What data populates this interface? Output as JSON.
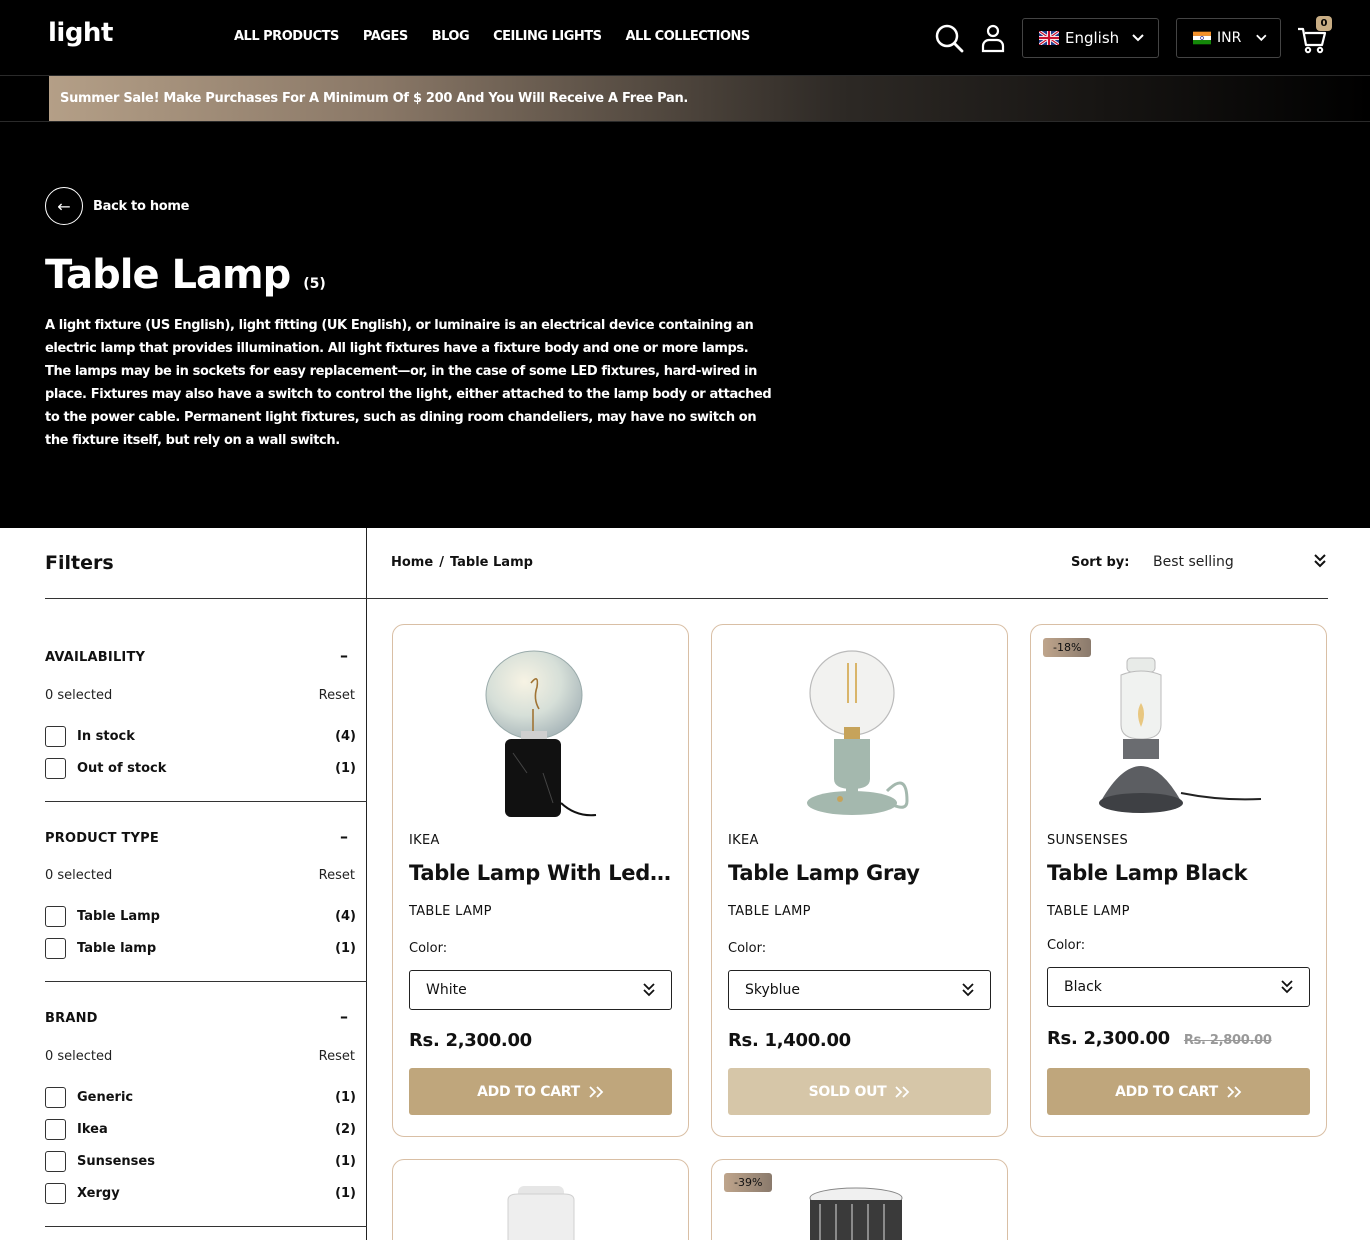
{
  "header": {
    "logo": "light",
    "nav": [
      "ALL PRODUCTS",
      "PAGES",
      "BLOG",
      "CEILING LIGHTS",
      "ALL COLLECTIONS"
    ],
    "language": "English",
    "currency": "INR",
    "cart_count": "0",
    "icons": [
      "search-icon",
      "user-icon",
      "uk-flag-icon",
      "india-flag-icon",
      "cart-icon"
    ]
  },
  "announcement": {
    "text": "Summer Sale! Make Purchases For A Minimum Of $ 200 And You Will Receive A Free Pan."
  },
  "hero": {
    "back_label": "Back to home",
    "title": "Table Lamp",
    "count": "(5)",
    "description": "A light fixture (US English), light fitting (UK English), or luminaire is an electrical device containing an electric lamp that provides illumination. All light fixtures have a fixture body and one or more lamps. The lamps may be in sockets for easy replacement—or, in the case of some LED fixtures, hard-wired in place. Fixtures may also have a switch to control the light, either attached to the lamp body or attached to the power cable. Permanent light fixtures, such as dining room chandeliers, may have no switch on the fixture itself, but rely on a wall switch."
  },
  "filters": {
    "title": "Filters",
    "groups": [
      {
        "title": "AVAILABILITY",
        "selected": "0 selected",
        "reset": "Reset",
        "options": [
          {
            "label": "In stock",
            "count": "(4)"
          },
          {
            "label": "Out of stock",
            "count": "(1)"
          }
        ]
      },
      {
        "title": "PRODUCT TYPE",
        "selected": "0 selected",
        "reset": "Reset",
        "options": [
          {
            "label": "Table Lamp",
            "count": "(4)"
          },
          {
            "label": "Table lamp",
            "count": "(1)"
          }
        ]
      },
      {
        "title": "BRAND",
        "selected": "0 selected",
        "reset": "Reset",
        "options": [
          {
            "label": "Generic",
            "count": "(1)"
          },
          {
            "label": "Ikea",
            "count": "(2)"
          },
          {
            "label": "Sunsenses",
            "count": "(1)"
          },
          {
            "label": "Xergy",
            "count": "(1)"
          }
        ]
      }
    ]
  },
  "toolbar": {
    "breadcrumb": [
      "Home",
      "/",
      "Table Lamp"
    ],
    "sort_label": "Sort by:",
    "sort_value": "Best selling"
  },
  "products": [
    {
      "brand": "IKEA",
      "name": "Table Lamp With Led Bulb Marble Black",
      "type": "TABLE LAMP",
      "color_label": "Color:",
      "color": "White",
      "price": "Rs. 2,300.00",
      "button": "ADD TO CART",
      "sold_out": false
    },
    {
      "brand": "IKEA",
      "name": "Table Lamp Gray",
      "type": "TABLE LAMP",
      "color_label": "Color:",
      "color": "Skyblue",
      "price": "Rs. 1,400.00",
      "button": "SOLD OUT",
      "sold_out": true
    },
    {
      "brand": "SUNSENSES",
      "name": "Table Lamp Black",
      "type": "TABLE LAMP",
      "color_label": "Color:",
      "color": "Black",
      "price": "Rs. 2,300.00",
      "old_price": "Rs. 2,800.00",
      "discount": "-18%",
      "button": "ADD TO CART",
      "sold_out": false
    },
    {
      "brand": "",
      "name": "",
      "type": ""
    },
    {
      "brand": "",
      "name": "",
      "type": "",
      "discount": "-39%"
    }
  ],
  "colors": {
    "accent": "#bfa67c",
    "accent_disabled": "#d6c6a8",
    "card_border": "#d9bfa5"
  }
}
